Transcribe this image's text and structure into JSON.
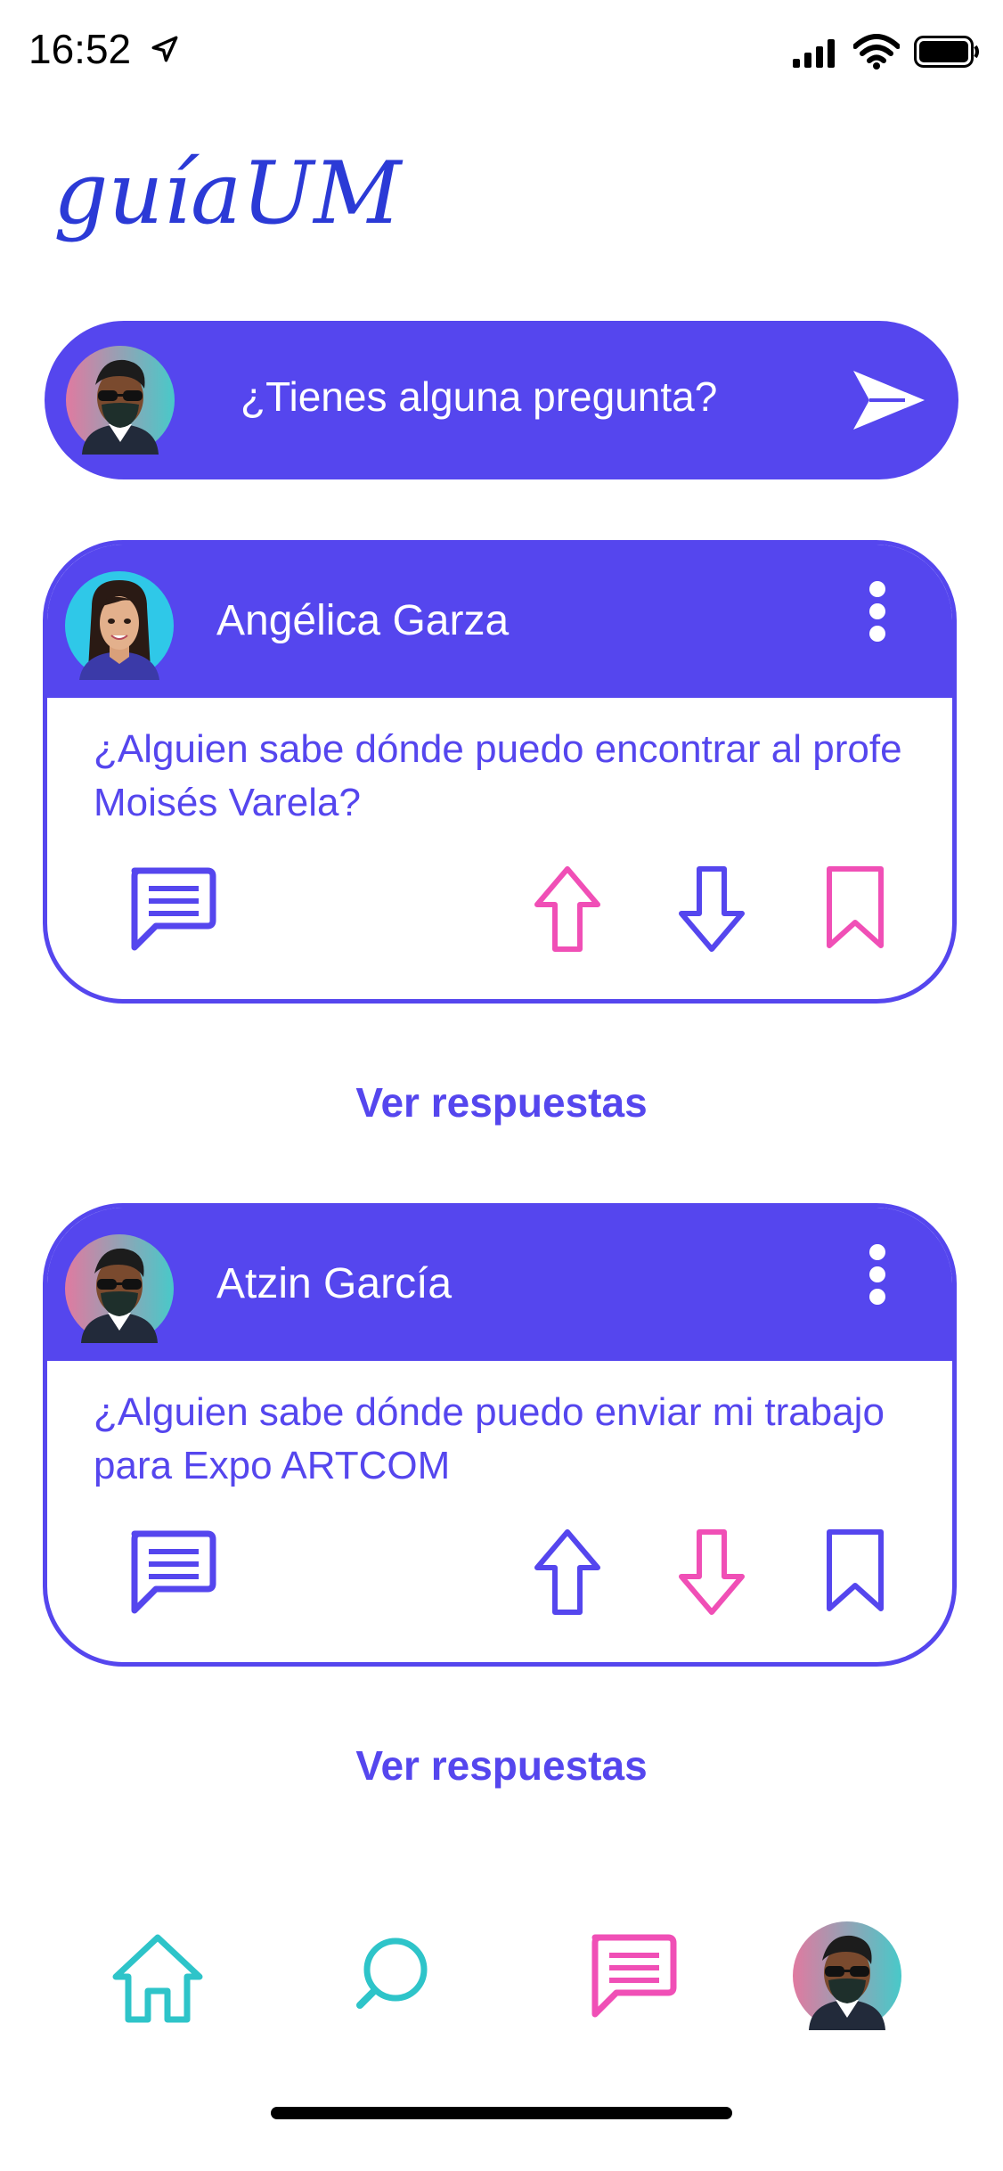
{
  "status_bar": {
    "time": "16:52"
  },
  "app": {
    "logo_text": "guíaUM"
  },
  "ask": {
    "placeholder": "¿Tienes alguna pregunta?"
  },
  "posts": [
    {
      "author": "Angélica Garza",
      "question": "¿Alguien sabe dónde puedo encontrar al profe Moisés Varela?",
      "replies_label": "Ver respuestas",
      "upvote_active": true,
      "downvote_active": false,
      "saved": true
    },
    {
      "author": "Atzin García",
      "question": "¿Alguien sabe dónde puedo enviar mi trabajo para Expo ARTCOM",
      "replies_label": "Ver respuestas",
      "upvote_active": false,
      "downvote_active": true,
      "saved": false
    }
  ],
  "colors": {
    "primary": "#5546ee",
    "accent_pink": "#f04fb6",
    "accent_teal": "#2ec4c9",
    "logo_blue": "#2b3ad6"
  },
  "tabs": [
    {
      "name": "home",
      "icon": "home-icon",
      "active": false
    },
    {
      "name": "search",
      "icon": "search-icon",
      "active": false
    },
    {
      "name": "messages",
      "icon": "chat-icon",
      "active": true
    },
    {
      "name": "profile",
      "icon": "avatar",
      "active": false
    }
  ]
}
